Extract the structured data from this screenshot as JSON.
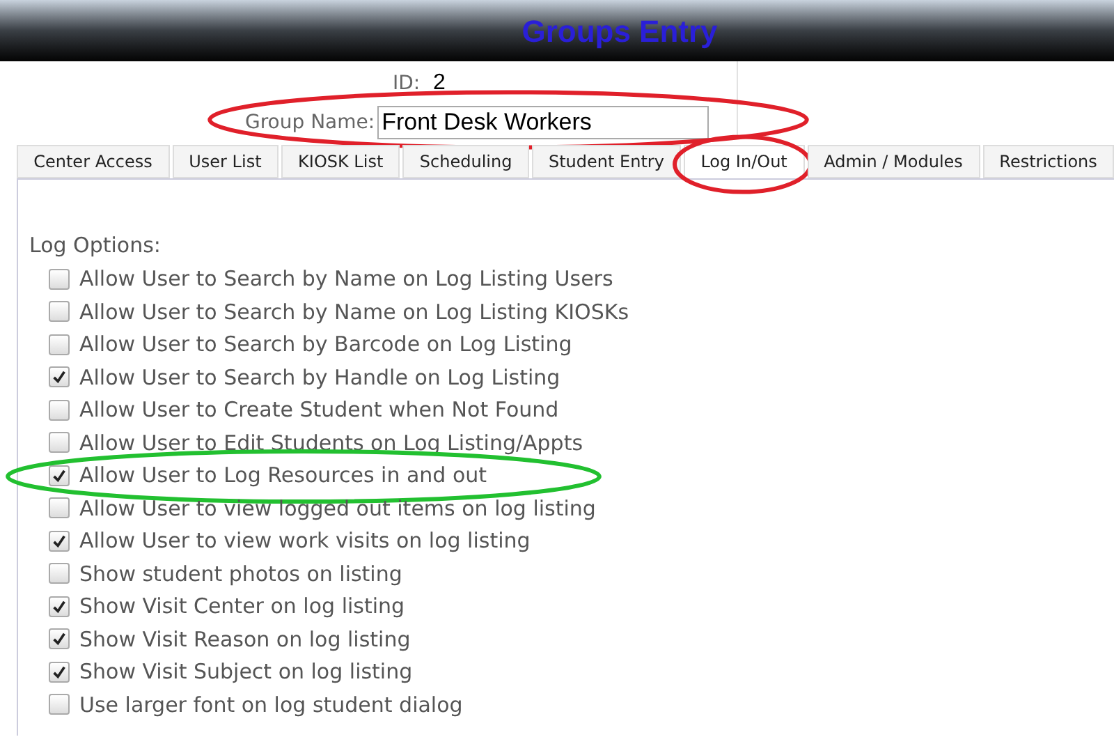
{
  "title": "Groups Entry",
  "id_label": "ID:",
  "id_value": "2",
  "group_name": {
    "label": "Group Name:",
    "value": "Front Desk Workers",
    "circle": {
      "color": "#e0202a"
    }
  },
  "tabs": [
    {
      "label": "Center Access",
      "selected": false
    },
    {
      "label": "User List",
      "selected": false
    },
    {
      "label": "KIOSK List",
      "selected": false
    },
    {
      "label": "Scheduling",
      "selected": false
    },
    {
      "label": "Student Entry",
      "selected": false
    },
    {
      "label": "Log In/Out",
      "selected": true,
      "circle": {
        "color": "#e0202a"
      }
    },
    {
      "label": "Admin / Modules",
      "selected": false
    },
    {
      "label": "Restrictions",
      "selected": false
    }
  ],
  "section_label": "Log Options:",
  "options": [
    {
      "label": "Allow User to Search by Name on Log Listing Users",
      "checked": false
    },
    {
      "label": "Allow User to Search by Name on Log Listing KIOSKs",
      "checked": false
    },
    {
      "label": "Allow User to Search by Barcode on Log Listing",
      "checked": false
    },
    {
      "label": "Allow User to Search by Handle on Log Listing",
      "checked": true
    },
    {
      "label": "Allow User to Create Student when Not Found",
      "checked": false
    },
    {
      "label": "Allow User to Edit Students on Log Listing/Appts",
      "checked": false
    },
    {
      "label": "Allow User to Log Resources in and out",
      "checked": true,
      "circle": {
        "color": "#22c030"
      }
    },
    {
      "label": "Allow User to view logged out items on log listing",
      "checked": false
    },
    {
      "label": "Allow User to view work visits on log listing",
      "checked": true
    },
    {
      "label": "Show student photos on listing",
      "checked": false
    },
    {
      "label": "Show Visit Center on log listing",
      "checked": true
    },
    {
      "label": "Show Visit Reason on log listing",
      "checked": true
    },
    {
      "label": "Show Visit Subject on log listing",
      "checked": true
    },
    {
      "label": "Use larger font on log student dialog",
      "checked": false
    }
  ]
}
